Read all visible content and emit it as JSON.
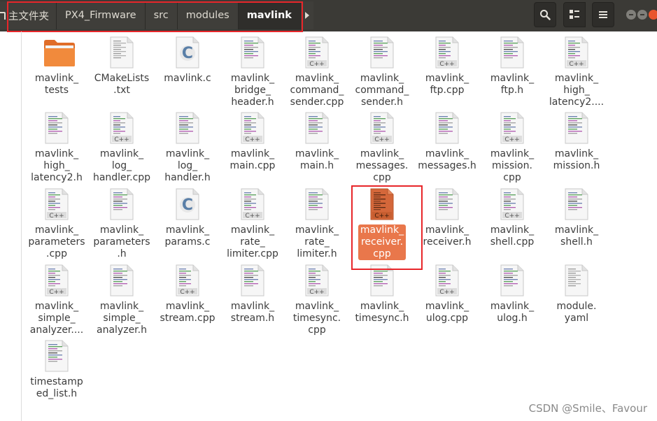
{
  "breadcrumb": [
    "主文件夹",
    "PX4_Firmware",
    "src",
    "modules",
    "mavlink"
  ],
  "files": [
    {
      "name": "mavlink_\ntests",
      "type": "folder"
    },
    {
      "name": "CMakeLists\n.txt",
      "type": "text"
    },
    {
      "name": "mavlink.c",
      "type": "c"
    },
    {
      "name": "mavlink_\nbridge_\nheader.h",
      "type": "h"
    },
    {
      "name": "mavlink_\ncommand_\nsender.cpp",
      "type": "cpp"
    },
    {
      "name": "mavlink_\ncommand_\nsender.h",
      "type": "h"
    },
    {
      "name": "mavlink_\nftp.cpp",
      "type": "cpp"
    },
    {
      "name": "mavlink_\nftp.h",
      "type": "h"
    },
    {
      "name": "mavlink_\nhigh_\nlatency2....",
      "type": "cpp"
    },
    {
      "name": "mavlink_\nhigh_\nlatency2.h",
      "type": "h"
    },
    {
      "name": "mavlink_\nlog_\nhandler.cpp",
      "type": "cpp"
    },
    {
      "name": "mavlink_\nlog_\nhandler.h",
      "type": "h"
    },
    {
      "name": "mavlink_\nmain.cpp",
      "type": "cpp"
    },
    {
      "name": "mavlink_\nmain.h",
      "type": "h"
    },
    {
      "name": "mavlink_\nmessages.\ncpp",
      "type": "cpp"
    },
    {
      "name": "mavlink_\nmessages.h",
      "type": "h"
    },
    {
      "name": "mavlink_\nmission.\ncpp",
      "type": "cpp"
    },
    {
      "name": "mavlink_\nmission.h",
      "type": "h"
    },
    {
      "name": "mavlink_\nparameters\n.cpp",
      "type": "cpp"
    },
    {
      "name": "mavlink_\nparameters\n.h",
      "type": "h"
    },
    {
      "name": "mavlink_\nparams.c",
      "type": "c"
    },
    {
      "name": "mavlink_\nrate_\nlimiter.cpp",
      "type": "cpp"
    },
    {
      "name": "mavlink_\nrate_\nlimiter.h",
      "type": "h"
    },
    {
      "name": "mavlink_\nreceiver.\ncpp",
      "type": "cpp",
      "selected": true
    },
    {
      "name": "mavlink_\nreceiver.h",
      "type": "h"
    },
    {
      "name": "mavlink_\nshell.cpp",
      "type": "cpp"
    },
    {
      "name": "mavlink_\nshell.h",
      "type": "h"
    },
    {
      "name": "mavlink_\nsimple_\nanalyzer....",
      "type": "cpp"
    },
    {
      "name": "mavlink_\nsimple_\nanalyzer.h",
      "type": "h"
    },
    {
      "name": "mavlink_\nstream.cpp",
      "type": "cpp"
    },
    {
      "name": "mavlink_\nstream.h",
      "type": "h"
    },
    {
      "name": "mavlink_\ntimesync.\ncpp",
      "type": "cpp"
    },
    {
      "name": "mavlink_\ntimesync.h",
      "type": "h"
    },
    {
      "name": "mavlink_\nulog.cpp",
      "type": "cpp"
    },
    {
      "name": "mavlink_\nulog.h",
      "type": "h"
    },
    {
      "name": "module.\nyaml",
      "type": "text"
    },
    {
      "name": "timestamp\ned_list.h",
      "type": "h"
    }
  ],
  "icons": {
    "search": "search-icon",
    "view": "grid-view-icon",
    "menu": "hamburger-menu-icon"
  },
  "colors": {
    "header": "#3b3a36",
    "selection": "#e9774b",
    "highlight_box": "#e8262a",
    "cpp_badge": "#dcdcdc"
  },
  "watermark": "CSDN @Smile、Favour"
}
